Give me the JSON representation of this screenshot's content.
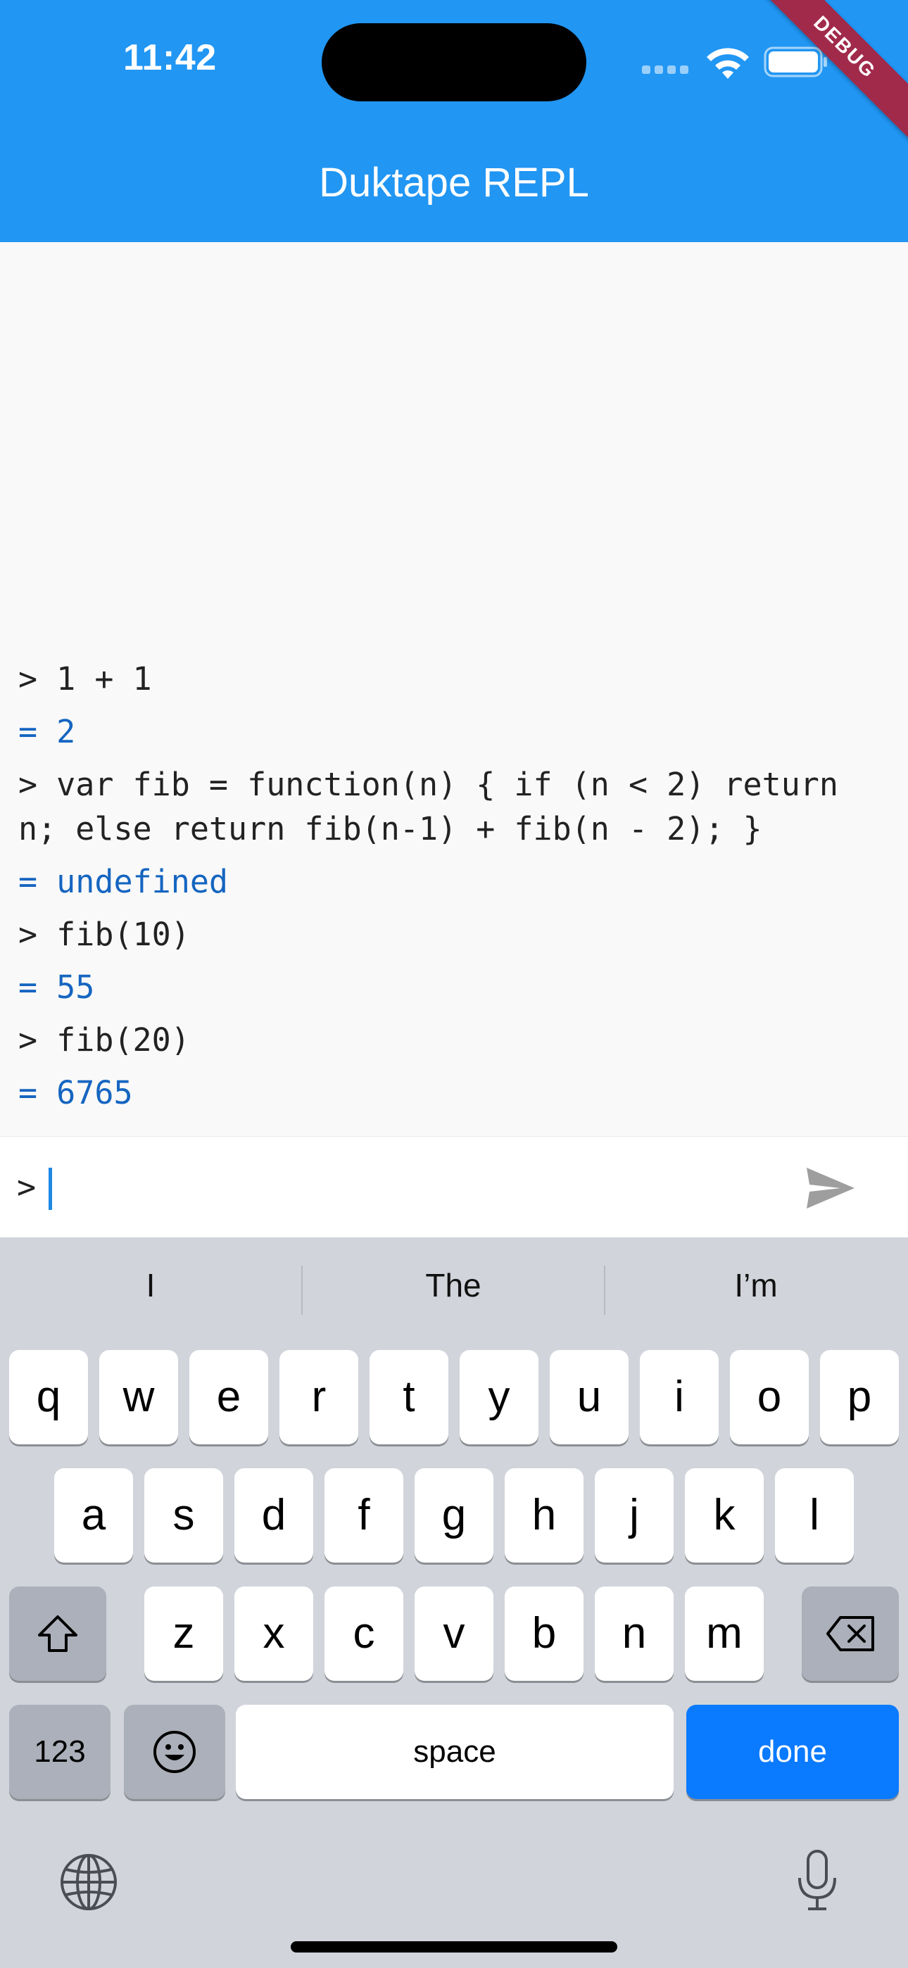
{
  "status_bar": {
    "time": "11:42",
    "icons": [
      "cellular-signal-icon",
      "wifi-icon",
      "battery-icon"
    ]
  },
  "debug_banner": "DEBUG",
  "app_bar": {
    "title": "Duktape REPL",
    "color": "#2196F3"
  },
  "console": {
    "lines": [
      {
        "kind": "input",
        "text": "> 1 + 1"
      },
      {
        "kind": "output",
        "text": "= 2"
      },
      {
        "kind": "input",
        "text": "> var fib = function(n) { if (n < 2) return n; else return fib(n-1) + fib(n - 2); }"
      },
      {
        "kind": "output",
        "text": "= undefined"
      },
      {
        "kind": "input",
        "text": "> fib(10)"
      },
      {
        "kind": "output",
        "text": "= 55"
      },
      {
        "kind": "input",
        "text": "> fib(20)"
      },
      {
        "kind": "output",
        "text": "= 6765"
      }
    ],
    "input_color": "#222222",
    "output_color": "#1565C0"
  },
  "input_bar": {
    "prompt": ">",
    "value": "",
    "send_icon": "send-icon"
  },
  "keyboard": {
    "suggestions": [
      "I",
      "The",
      "I’m"
    ],
    "row1": [
      "q",
      "w",
      "e",
      "r",
      "t",
      "y",
      "u",
      "i",
      "o",
      "p"
    ],
    "row2": [
      "a",
      "s",
      "d",
      "f",
      "g",
      "h",
      "j",
      "k",
      "l"
    ],
    "row3": [
      "z",
      "x",
      "c",
      "v",
      "b",
      "n",
      "m"
    ],
    "numbers_label": "123",
    "space_label": "space",
    "done_label": "done",
    "accent": "#0A7AFF"
  }
}
